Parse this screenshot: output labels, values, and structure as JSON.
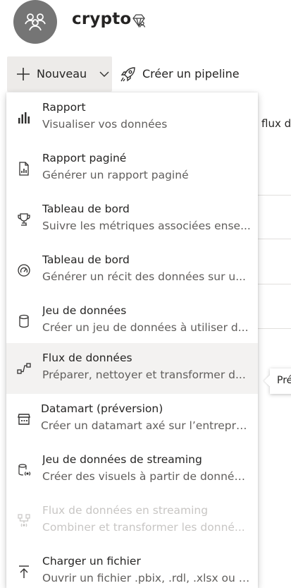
{
  "workspace": {
    "name": "crypto"
  },
  "toolbar": {
    "new_label": "Nouveau",
    "pipeline_label": "Créer un pipeline"
  },
  "background": {
    "partial_text": "flux d",
    "tooltip_text": "Pré"
  },
  "menu": {
    "items": [
      {
        "title": "Rapport",
        "description": "Visualiser vos données",
        "icon": "bar-chart-icon",
        "state": "normal"
      },
      {
        "title": "Rapport paginé",
        "description": "Générer un rapport paginé",
        "icon": "paginated-report-icon",
        "state": "normal"
      },
      {
        "title": "Tableau de bord",
        "description": "Suivre les métriques associées ense...",
        "icon": "trophy-icon",
        "state": "normal"
      },
      {
        "title": "Tableau de bord",
        "description": "Générer un récit des données sur u...",
        "icon": "gauge-icon",
        "state": "normal"
      },
      {
        "title": "Jeu de données",
        "description": "Créer un jeu de données à utiliser d...",
        "icon": "database-icon",
        "state": "normal"
      },
      {
        "title": "Flux de données",
        "description": "Préparer, nettoyer et transformer d...",
        "icon": "dataflow-icon",
        "state": "hover"
      },
      {
        "title": "Datamart (préversion)",
        "description": "Créer un datamart axé sur l’entreprise",
        "icon": "datamart-icon",
        "state": "normal"
      },
      {
        "title": "Jeu de données de streaming",
        "description": "Créer des visuels à partir de donnée...",
        "icon": "streaming-dataset-icon",
        "state": "normal"
      },
      {
        "title": "Flux de données en streaming",
        "description": "Combiner et transformer les donné...",
        "icon": "streaming-dataflow-icon",
        "state": "disabled"
      },
      {
        "title": "Charger un fichier",
        "description": "Ouvrir un fichier .pbix, .rdl, .xlsx ou ....",
        "icon": "upload-icon",
        "state": "normal"
      }
    ]
  }
}
